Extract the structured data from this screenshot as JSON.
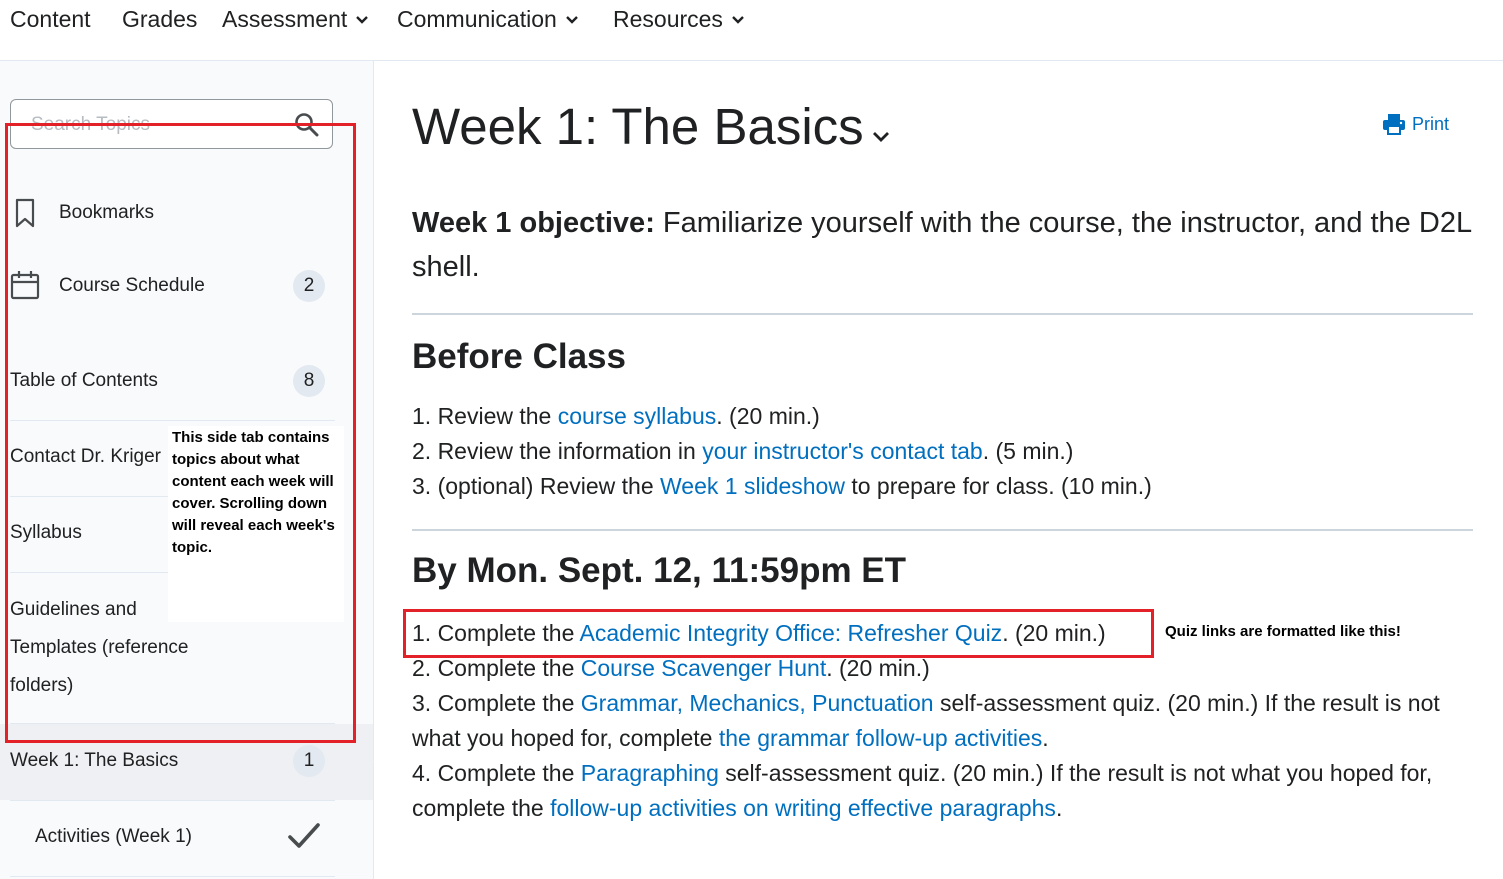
{
  "nav": {
    "items": [
      {
        "label": "Content",
        "dropdown": false
      },
      {
        "label": "Grades",
        "dropdown": false
      },
      {
        "label": "Assessment",
        "dropdown": true
      },
      {
        "label": "Communication",
        "dropdown": true
      },
      {
        "label": "Resources",
        "dropdown": true
      }
    ]
  },
  "sidebar": {
    "search_placeholder": "Search Topics",
    "items": [
      {
        "label": "Bookmarks",
        "icon": "bookmark-icon"
      },
      {
        "label": "Course Schedule",
        "icon": "calendar-icon",
        "count": "2"
      },
      {
        "label": "Table of Contents",
        "count": "8"
      },
      {
        "label": "Contact Dr. Kriger"
      },
      {
        "label": "Syllabus"
      },
      {
        "label": "Guidelines and Templates (reference folders)"
      },
      {
        "label": "Week 1: The Basics",
        "count": "1",
        "active": true
      },
      {
        "label": "Activities (Week 1)",
        "status": "checkmark-icon"
      }
    ]
  },
  "annotations": {
    "side_note": "This side tab contains topics about what content each week will cover. Scrolling down will reveal each week's topic.",
    "quiz_note": "Quiz links are formatted like this!",
    "highlight_color": "#e32129"
  },
  "main": {
    "title": "Week 1: The Basics",
    "print_label": "Print",
    "objective_bold": "Week 1 objective:",
    "objective_text": " Familiarize yourself with the course, the instructor, and the D2L shell.",
    "before_class": {
      "heading": "Before Class",
      "items": [
        {
          "pre": "1. Review the ",
          "link": "course syllabus",
          "post": ". (20 min.)"
        },
        {
          "pre": "2. Review the information in ",
          "link": "your instructor's contact tab",
          "post": ". (5 min.)"
        },
        {
          "pre": "3. (optional) Review the ",
          "link": "Week 1 slideshow",
          "post": " to prepare for class. (10 min.)"
        }
      ]
    },
    "deadline": {
      "heading": "By Mon. Sept. 12, 11:59pm ET",
      "items": [
        {
          "pre": "1. Complete the ",
          "link": "Academic Integrity Office: Refresher Quiz",
          "post": ". (20 min.)"
        },
        {
          "pre": "2. Complete the ",
          "link": "Course Scavenger Hunt",
          "post": ". (20 min.)"
        },
        {
          "pre": "3. Complete the ",
          "link": "Grammar, Mechanics, Punctuation",
          "post": " self-assessment quiz. (20 min.) If the result is not what you hoped for, complete ",
          "link2": "the grammar follow-up activities",
          "post2": "."
        },
        {
          "pre": "4. Complete the ",
          "link": "Paragraphing",
          "post": " self-assessment quiz. (20 min.) If the result is not what you hoped for, complete the ",
          "link2": "follow-up activities on writing effective paragraphs",
          "post2": "."
        }
      ]
    }
  },
  "colors": {
    "link": "#006fbf",
    "text": "#202122",
    "badge": "#e3e9f1"
  }
}
